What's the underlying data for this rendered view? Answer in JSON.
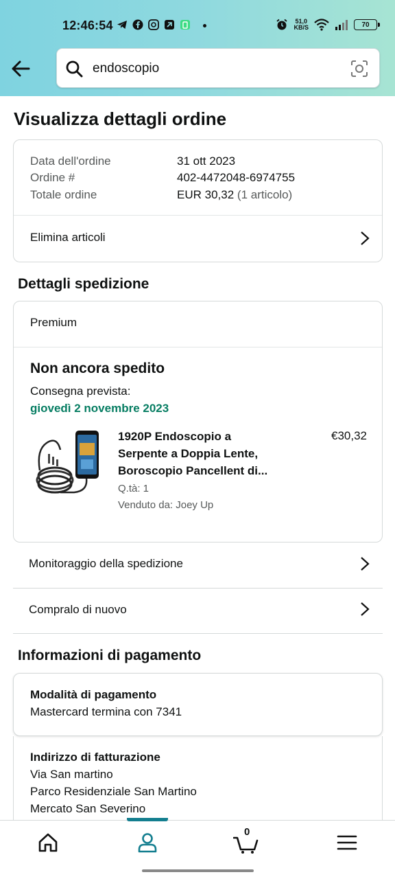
{
  "status_bar": {
    "time": "12:46:54",
    "speed_top": "51,0",
    "speed_unit": "KB/S",
    "battery": "70"
  },
  "search": {
    "query": "endoscopio"
  },
  "page_title": "Visualizza dettagli ordine",
  "order_summary": {
    "date_label": "Data dell'ordine",
    "date_value": "31 ott 2023",
    "number_label": "Ordine #",
    "number_value": "402-4472048-6974755",
    "total_label": "Totale ordine",
    "total_value": "EUR 30,32",
    "total_items": "(1 articolo)",
    "delete_items": "Elimina articoli"
  },
  "shipping": {
    "heading": "Dettagli spedizione",
    "service": "Premium",
    "status": "Non ancora spedito",
    "delivery_label": "Consegna prevista:",
    "delivery_date": "giovedì 2 novembre 2023",
    "product": {
      "title": "1920P Endoscopio a Serpente a Doppia Lente, Boroscopio Pancellent di...",
      "price": "€30,32",
      "qty": "Q.tà: 1",
      "seller": "Venduto da: Joey Up"
    },
    "track": "Monitoraggio della spedizione",
    "buy_again": "Compralo di nuovo"
  },
  "payment": {
    "heading": "Informazioni di pagamento",
    "method_label": "Modalità di pagamento",
    "method_value": "Mastercard  termina con 7341",
    "billing_label": "Indirizzo di fatturazione",
    "billing_line1": "Via San martino",
    "billing_line2": "Parco Residenziale San Martino",
    "billing_line3": "Mercato San Severino"
  },
  "bottom_nav": {
    "cart_count": "0",
    "active": "account"
  },
  "colors": {
    "header_gradient_start": "#7fd3e0",
    "header_gradient_end": "#a7e4d3",
    "delivery_green": "#067d62",
    "nav_active": "#137e8f"
  }
}
